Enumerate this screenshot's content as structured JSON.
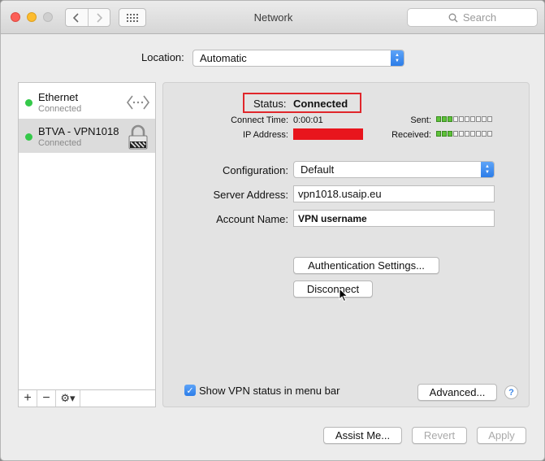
{
  "window": {
    "title": "Network",
    "search_placeholder": "Search"
  },
  "location": {
    "label": "Location:",
    "value": "Automatic"
  },
  "services": [
    {
      "name": "Ethernet",
      "state": "Connected",
      "icon": "ethernet-arrows-icon",
      "selected": false
    },
    {
      "name": "BTVA - VPN1018",
      "state": "Connected",
      "icon": "vpn-lock-icon",
      "selected": true
    }
  ],
  "sidebar_toolbar": {
    "add": "+",
    "remove": "−",
    "gear": "⚙▾"
  },
  "status": {
    "label": "Status:",
    "value": "Connected",
    "connect_time_label": "Connect Time:",
    "connect_time": "0:00:01",
    "ip_label": "IP Address:",
    "sent_label": "Sent:",
    "received_label": "Received:",
    "sent_level": 3,
    "received_level": 3,
    "meter_segments": 10
  },
  "form": {
    "configuration_label": "Configuration:",
    "configuration_value": "Default",
    "server_label": "Server Address:",
    "server_value": "vpn1018.usaip.eu",
    "account_label": "Account Name:",
    "account_value": "VPN username"
  },
  "buttons": {
    "auth": "Authentication Settings...",
    "disconnect": "Disconnect",
    "advanced": "Advanced...",
    "help": "?",
    "assist": "Assist Me...",
    "revert": "Revert",
    "apply": "Apply"
  },
  "show_status": {
    "label": "Show VPN status in menu bar",
    "checked": true
  },
  "colors": {
    "status_dot": "#35c94a",
    "highlight_box": "#e0262b",
    "redaction": "#e8151d",
    "accent": "#2c7de8"
  }
}
